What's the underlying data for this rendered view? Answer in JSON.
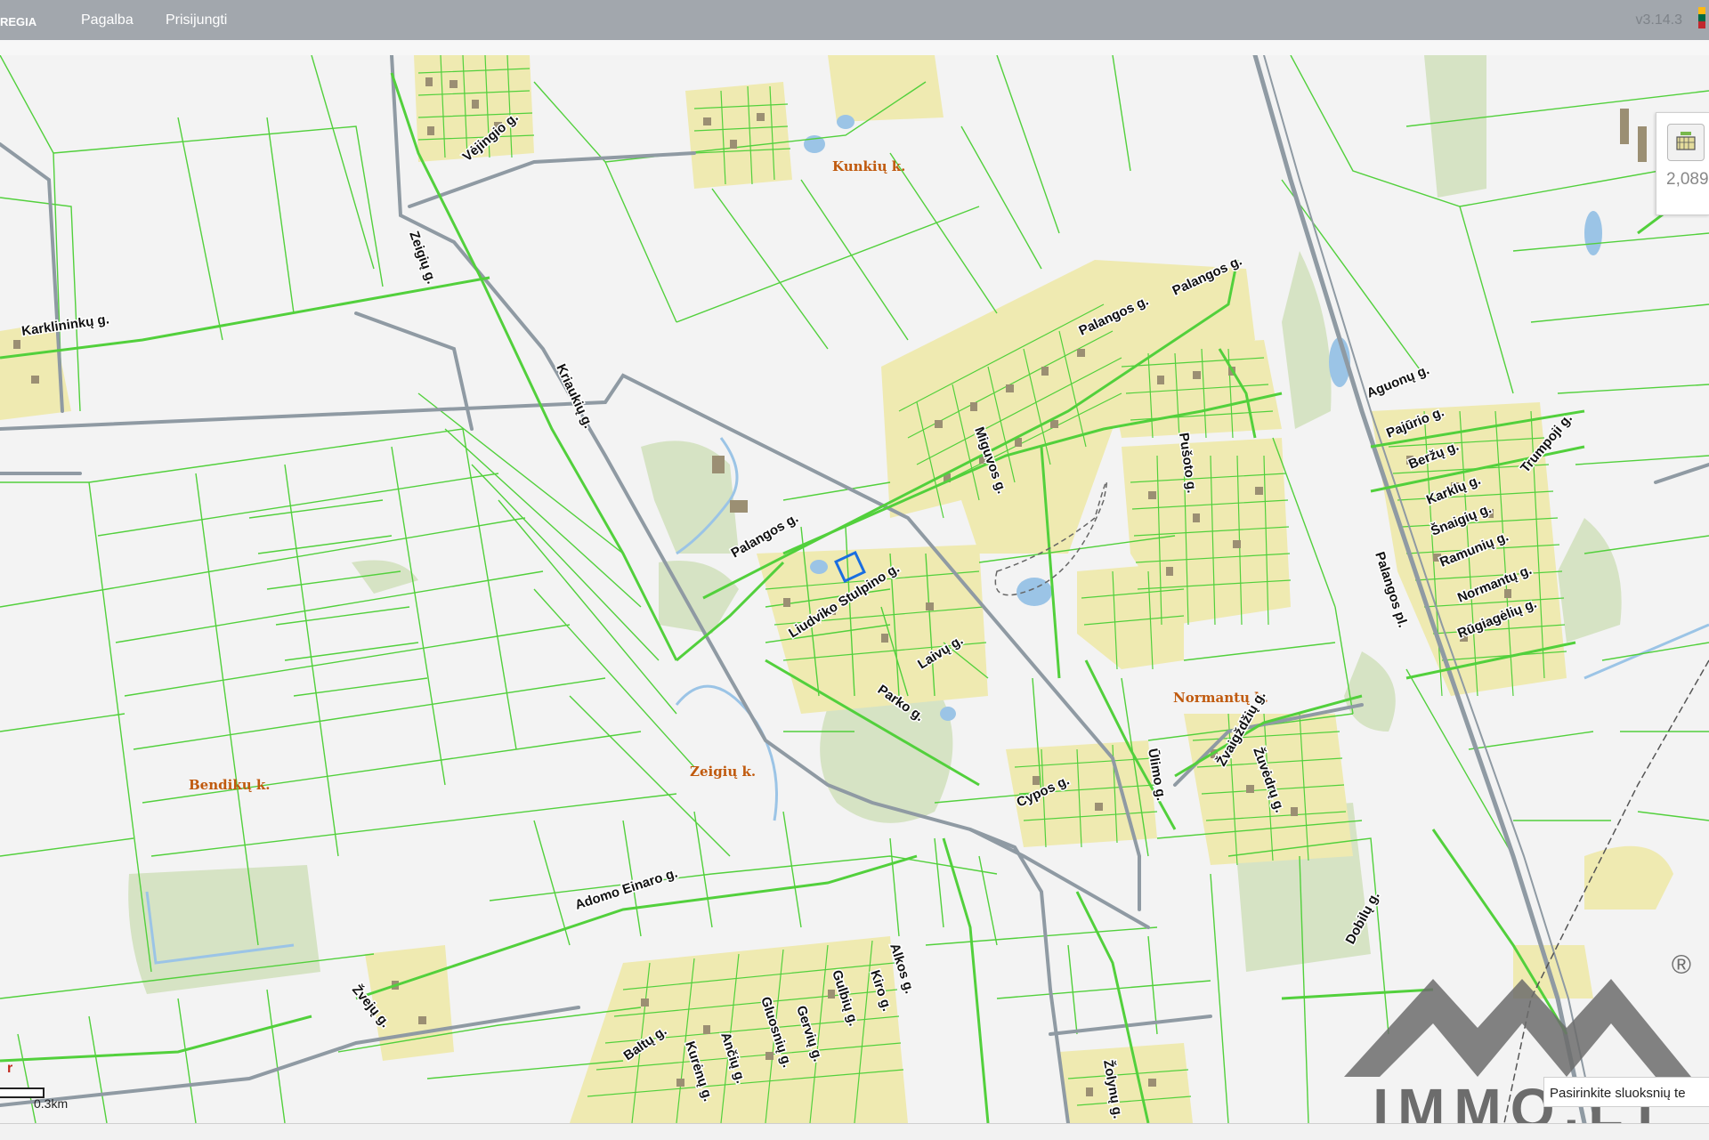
{
  "header": {
    "brand": "REGIA",
    "menu": [
      "Pagalba",
      "Prisijungti"
    ],
    "version": "v3.14.3"
  },
  "side_panel": {
    "icon": "layers-icon",
    "count": "2,089"
  },
  "scale": {
    "label": "0.3km",
    "mark": "r"
  },
  "layer_hint": "Pasirinkite sluoksnių te",
  "watermark": {
    "text": "IMMO.LT",
    "registered": "®"
  },
  "colors": {
    "parcel": "#52d03c",
    "road": "#8f9aa3",
    "settlement": "#efeab1",
    "water": "#9bc4e6",
    "forest": "#d6e3c4",
    "selection": "#1a6ee0"
  },
  "places": [
    {
      "name": "Kunkių k.",
      "id": "kunkiu"
    },
    {
      "name": "Normantų k.",
      "id": "normantu"
    },
    {
      "name": "Zeigių k.",
      "id": "zeigiu"
    },
    {
      "name": "Bendikų k.",
      "id": "bendiku"
    }
  ],
  "streets": [
    "Vėjingio g.",
    "Zeigių g.",
    "Karklininkų g.",
    "Kriaukių g.",
    "Palangos g.",
    "Palangos g.",
    "Palangos g.",
    "Miguvos g.",
    "Pušoto g.",
    "Aguonų g.",
    "Pajūrio g.",
    "Beržų g.",
    "Karklų g.",
    "Šnaigių g.",
    "Ramunių g.",
    "Normantų g.",
    "Rūgiagėlių g.",
    "Trumpoji g.",
    "Palangos pl.",
    "Liudviko Stulpino g.",
    "Laivų g.",
    "Parko g.",
    "Ūlimo g.",
    "Cypos g.",
    "Žvaigždžių g.",
    "Žuvėdrų g.",
    "Dobilų g.",
    "Adomo Einaro g.",
    "Žvejų g.",
    "Alkos g.",
    "Kiro g.",
    "Gulbių g.",
    "Gervių g.",
    "Gluosnių g.",
    "Ančių g.",
    "Kurėnų g.",
    "Baltų g.",
    "Žolynų g."
  ]
}
